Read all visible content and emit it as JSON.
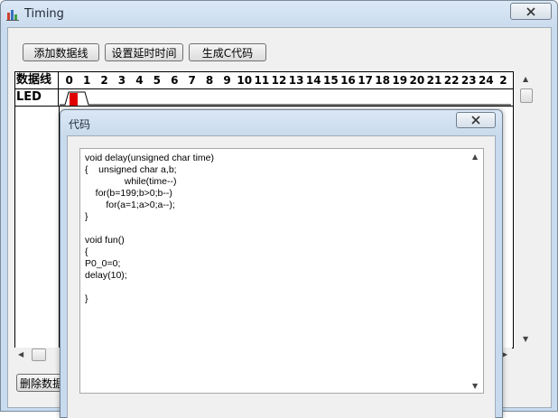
{
  "window": {
    "title": "Timing"
  },
  "toolbar": {
    "add_line": "添加数据线",
    "set_delay": "设置延时时间",
    "gen_code": "生成C代码"
  },
  "grid": {
    "header_label": "数据线",
    "ticks": [
      "0",
      "1",
      "2",
      "3",
      "4",
      "5",
      "6",
      "7",
      "8",
      "9",
      "10",
      "11",
      "12",
      "13",
      "14",
      "15",
      "16",
      "17",
      "18",
      "19",
      "20",
      "21",
      "22",
      "23",
      "24",
      "2"
    ],
    "rows": [
      {
        "label": "LED"
      }
    ],
    "pulse_color": "#e00000"
  },
  "bottom": {
    "delete_button": "删除数据"
  },
  "dialog": {
    "title": "代码",
    "code": "void delay(unsigned char time)\n{    unsigned char a,b;\n               while(time--)\n    for(b=199;b>0;b--)\n        for(a=1;a>0;a--);\n}\n\nvoid fun()\n{\nP0_0=0;\ndelay(10);\n\n}"
  }
}
